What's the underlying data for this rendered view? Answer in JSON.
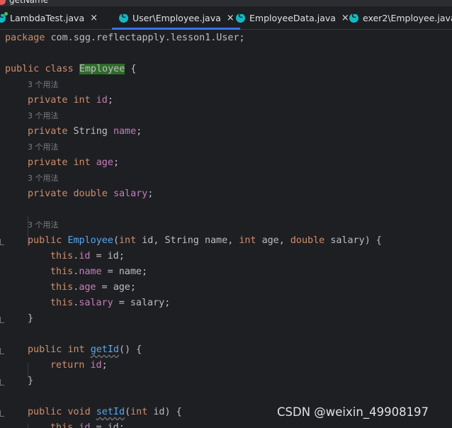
{
  "top_strip": {
    "icon": "method-icon",
    "label": "getName"
  },
  "tabs": [
    {
      "label": "LambdaTest.java",
      "close": "×",
      "active": false
    },
    {
      "label": "User\\Employee.java",
      "close": "×",
      "active": true
    },
    {
      "label": "EmployeeData.java",
      "close": "×",
      "active": false
    },
    {
      "label": "exer2\\Employee.java",
      "close": "×",
      "active": false
    }
  ],
  "code": {
    "package_kw": "package",
    "package_name": " com.sgg.reflectapply.lesson1.User;",
    "public_kw": "public",
    "class_kw": "class",
    "class_name": "Employee",
    "open_brace": " {",
    "usage_hint": "3 个用法",
    "private_kw": "private",
    "int_kw": "int",
    "double_kw": "double",
    "string_type": "String",
    "void_kw": "void",
    "return_kw": "return",
    "this_kw": "this",
    "field_id": "id",
    "field_name": "name",
    "field_age": "age",
    "field_salary": "salary",
    "semicolon": ";",
    "ctor_name": "Employee",
    "getter_name": "getId",
    "setter_name": "setId",
    "close_brace": "}"
  },
  "watermark": "CSDN @weixin_49908197"
}
